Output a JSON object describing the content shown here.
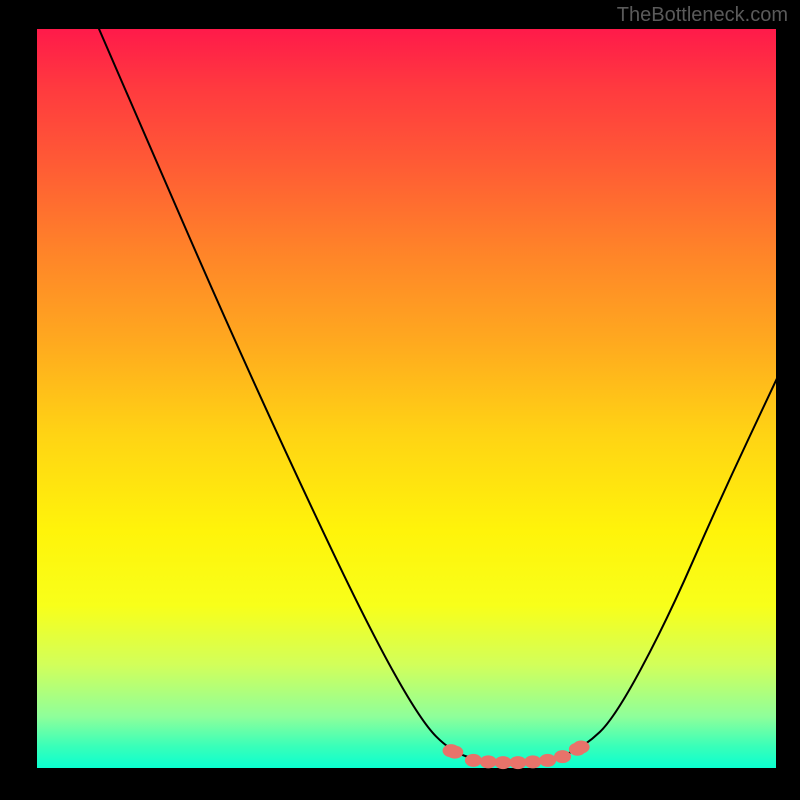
{
  "watermark": "TheBottleneck.com",
  "chart_data": {
    "type": "line",
    "title": "",
    "xlabel": "",
    "ylabel": "",
    "xlim": [
      0,
      100
    ],
    "ylim": [
      0,
      100
    ],
    "grid": false,
    "legend": false,
    "curve_points": [
      {
        "x": 8.5,
        "y": 100
      },
      {
        "x": 15,
        "y": 85
      },
      {
        "x": 25,
        "y": 62
      },
      {
        "x": 35,
        "y": 40
      },
      {
        "x": 45,
        "y": 19
      },
      {
        "x": 52,
        "y": 6.5
      },
      {
        "x": 56,
        "y": 2.5
      },
      {
        "x": 60,
        "y": 1.2
      },
      {
        "x": 65,
        "y": 1.0
      },
      {
        "x": 70,
        "y": 1.5
      },
      {
        "x": 74,
        "y": 3.2
      },
      {
        "x": 78,
        "y": 7
      },
      {
        "x": 85,
        "y": 20
      },
      {
        "x": 92,
        "y": 36
      },
      {
        "x": 100,
        "y": 53
      }
    ],
    "markers": [
      {
        "x": 56,
        "y": 2.6
      },
      {
        "x": 56.5,
        "y": 2.4
      },
      {
        "x": 59,
        "y": 1.3
      },
      {
        "x": 61,
        "y": 1.1
      },
      {
        "x": 63,
        "y": 1.0
      },
      {
        "x": 65,
        "y": 1.0
      },
      {
        "x": 67,
        "y": 1.1
      },
      {
        "x": 69,
        "y": 1.3
      },
      {
        "x": 71,
        "y": 1.8
      },
      {
        "x": 73,
        "y": 2.8
      },
      {
        "x": 73.5,
        "y": 3.1
      }
    ],
    "description": "V-shaped bottleneck curve. Color gradient background from red (top, high bottleneck) through orange, yellow to green (bottom, low bottleneck). Black curve descends steeply from upper-left, reaches minimum around x=60-70 where pink/salmon markers cluster, then rises toward upper-right."
  }
}
